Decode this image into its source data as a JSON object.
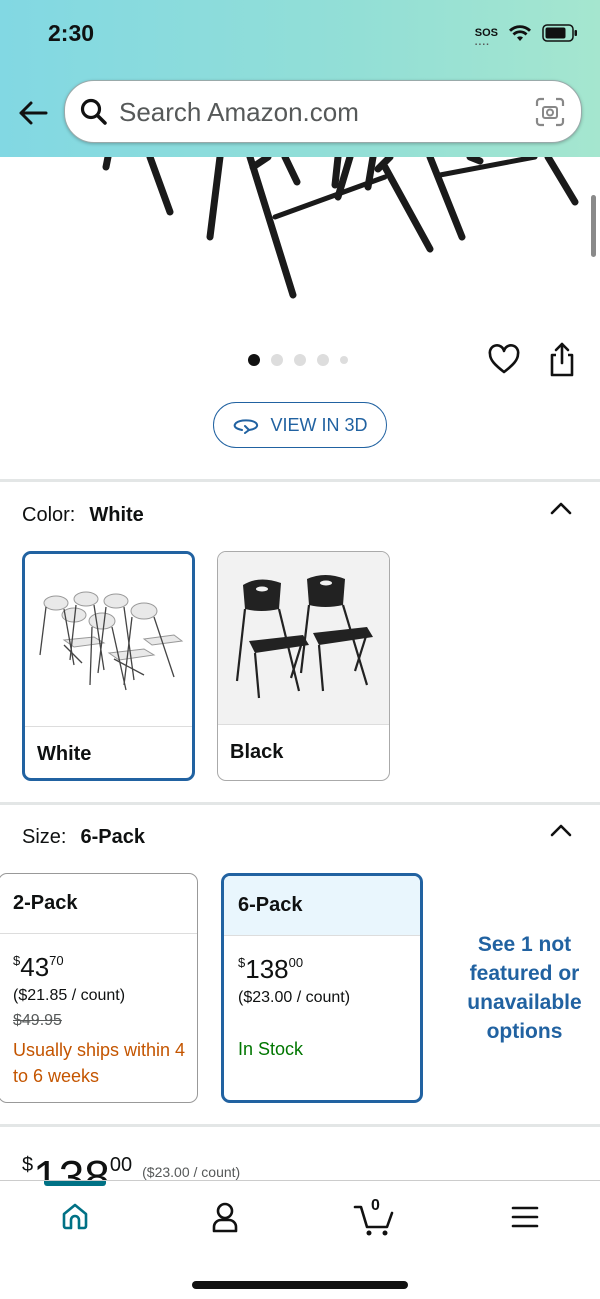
{
  "status_bar": {
    "time": "2:30",
    "sos": "SOS"
  },
  "search": {
    "placeholder": "Search Amazon.com"
  },
  "actions": {
    "view_3d_label": "VIEW IN 3D"
  },
  "color": {
    "label": "Color:",
    "selected": "White",
    "options": [
      "White",
      "Black"
    ]
  },
  "size": {
    "label": "Size:",
    "selected": "6-Pack",
    "options": [
      {
        "name": "2-Pack",
        "price_whole": "43",
        "price_fraction": "70",
        "per_count": "($21.85 / count)",
        "list_price": "$49.95",
        "availability": "Usually ships within 4 to 6 weeks"
      },
      {
        "name": "6-Pack",
        "price_whole": "138",
        "price_fraction": "00",
        "per_count": "($23.00 / count)",
        "availability": "In Stock"
      }
    ],
    "see_more": "See 1 not featured or unavailable options"
  },
  "summary": {
    "currency": "$",
    "price_whole": "138",
    "price_fraction": "00",
    "per_count": "($23.00 / count)"
  },
  "nav": {
    "cart_count": "0",
    "items": [
      "home-icon",
      "account-icon",
      "cart-icon",
      "menu-icon"
    ]
  },
  "colors": {
    "accent": "#2162a1",
    "teal": "#007185",
    "orange": "#c45500",
    "green": "#007600"
  }
}
